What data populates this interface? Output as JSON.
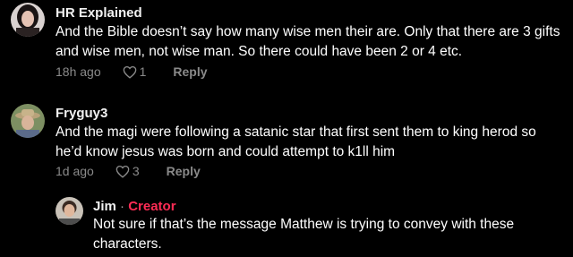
{
  "comments": [
    {
      "username": "HR Explained",
      "text": "And the Bible doesn’t say how many wise men their are. Only that there are 3 gifts and wise men, not wise man. So there could have been 2 or 4 etc.",
      "time": "18h ago",
      "likes": "1",
      "reply_label": "Reply",
      "avatar_icon": "user-avatar"
    },
    {
      "username": "Fryguy3",
      "text": "And the magi were following a satanic star that first sent them to king herod so he’d know jesus was born and could attempt to k1ll him",
      "time": "1d ago",
      "likes": "3",
      "reply_label": "Reply",
      "avatar_icon": "user-avatar"
    }
  ],
  "reply": {
    "username": "Jim",
    "separator": "·",
    "badge": "Creator",
    "text": "Not sure if that’s the message Matthew is trying to convey with these characters.",
    "avatar_icon": "user-avatar"
  },
  "colors": {
    "background": "#000000",
    "creator_badge": "#fe2c55",
    "meta_text": "#8a8a8a"
  }
}
